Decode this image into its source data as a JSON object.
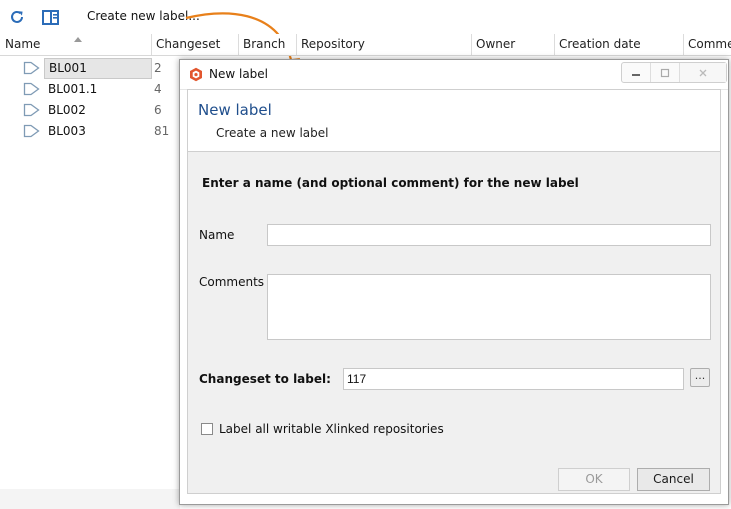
{
  "toolbar": {
    "refresh_icon": "refresh-icon",
    "panel_icon": "split-panel-icon",
    "action_label": "Create new label...",
    "arrow_color": "#e8801a"
  },
  "grid": {
    "columns": [
      "Name",
      "Changeset",
      "Branch",
      "Repository",
      "Owner",
      "Creation date",
      "Comme"
    ],
    "rows": [
      {
        "name": "BL001",
        "changeset": "2",
        "selected": true
      },
      {
        "name": "BL001.1",
        "changeset": "4"
      },
      {
        "name": "BL002",
        "changeset": "6"
      },
      {
        "name": "BL003",
        "changeset": "81"
      }
    ]
  },
  "dialog": {
    "title": "New label",
    "header_title": "New label",
    "header_subtitle": "Create a new label",
    "instruction": "Enter a name (and optional comment) for the new label",
    "name_label": "Name",
    "name_value": "",
    "comments_label": "Comments",
    "comments_value": "",
    "changeset_label": "Changeset to label:",
    "changeset_value": "117",
    "browse_label": "...",
    "checkbox_label": "Label all writable Xlinked repositories",
    "checkbox_checked": false,
    "ok_label": "OK",
    "cancel_label": "Cancel",
    "title_color": "#1f4e8c"
  }
}
